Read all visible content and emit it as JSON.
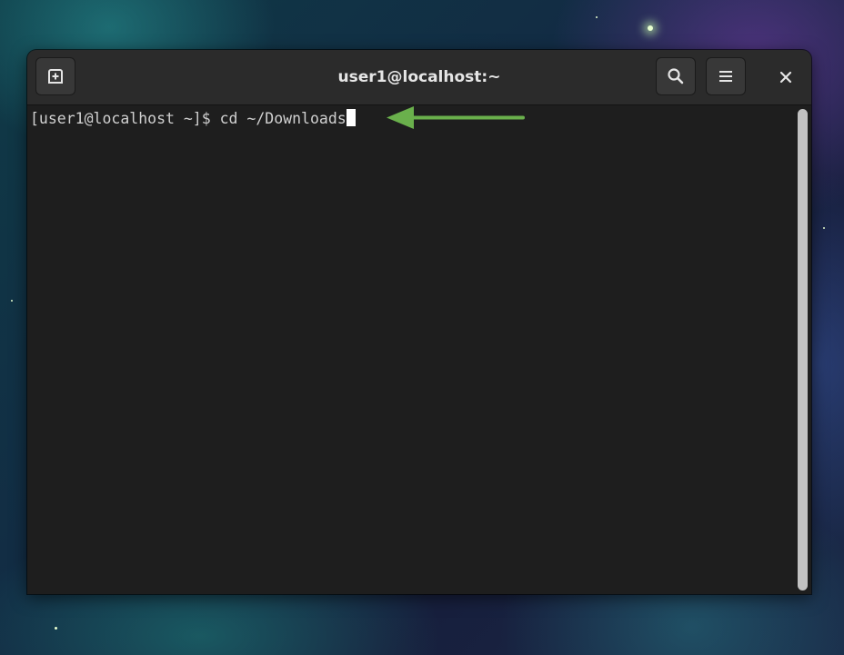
{
  "window": {
    "title": "user1@localhost:~"
  },
  "headerbar": {
    "new_tab_icon": "new-tab-icon",
    "search_icon": "search-icon",
    "menu_icon": "hamburger-menu-icon",
    "close_icon": "close-icon"
  },
  "terminal": {
    "prompt": "[user1@localhost ~]$ ",
    "command": "cd ~/Downloads"
  },
  "annotation": {
    "arrow_color": "#6ab04c"
  },
  "colors": {
    "terminal_bg": "#1e1e1e",
    "headerbar_bg": "#2b2b2b",
    "text": "#d0d0d0"
  }
}
